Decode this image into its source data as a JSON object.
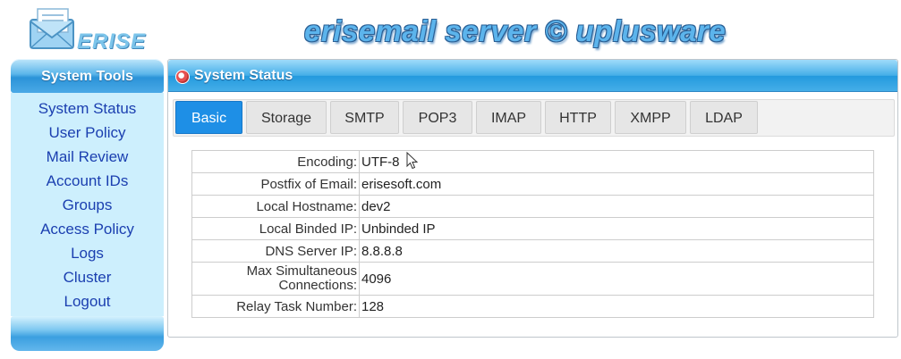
{
  "header": {
    "logo_text": "ERISE",
    "site_title": "erisemail server © uplusware"
  },
  "sidebar": {
    "title": "System Tools",
    "items": [
      {
        "label": "System Status"
      },
      {
        "label": "User Policy"
      },
      {
        "label": "Mail Review"
      },
      {
        "label": "Account IDs"
      },
      {
        "label": "Groups"
      },
      {
        "label": "Access Policy"
      },
      {
        "label": "Logs"
      },
      {
        "label": "Cluster"
      },
      {
        "label": "Logout"
      }
    ]
  },
  "panel": {
    "title": "System Status",
    "tabs": [
      {
        "label": "Basic",
        "active": true
      },
      {
        "label": "Storage",
        "active": false
      },
      {
        "label": "SMTP",
        "active": false
      },
      {
        "label": "POP3",
        "active": false
      },
      {
        "label": "IMAP",
        "active": false
      },
      {
        "label": "HTTP",
        "active": false
      },
      {
        "label": "XMPP",
        "active": false
      },
      {
        "label": "LDAP",
        "active": false
      }
    ],
    "rows": [
      {
        "label": "Encoding:",
        "value": "UTF-8"
      },
      {
        "label": "Postfix of Email:",
        "value": "erisesoft.com"
      },
      {
        "label": "Local Hostname:",
        "value": "dev2"
      },
      {
        "label": "Local Binded IP:",
        "value": "Unbinded IP"
      },
      {
        "label": "DNS Server IP:",
        "value": "8.8.8.8"
      },
      {
        "label": "Max Simultaneous Connections:",
        "value": "4096"
      },
      {
        "label": "Relay Task Number:",
        "value": "128"
      }
    ]
  },
  "colors": {
    "accent": "#1e8fe6",
    "nav_link": "#1b3fb0",
    "sidebar_bg": "#cdeffd"
  }
}
